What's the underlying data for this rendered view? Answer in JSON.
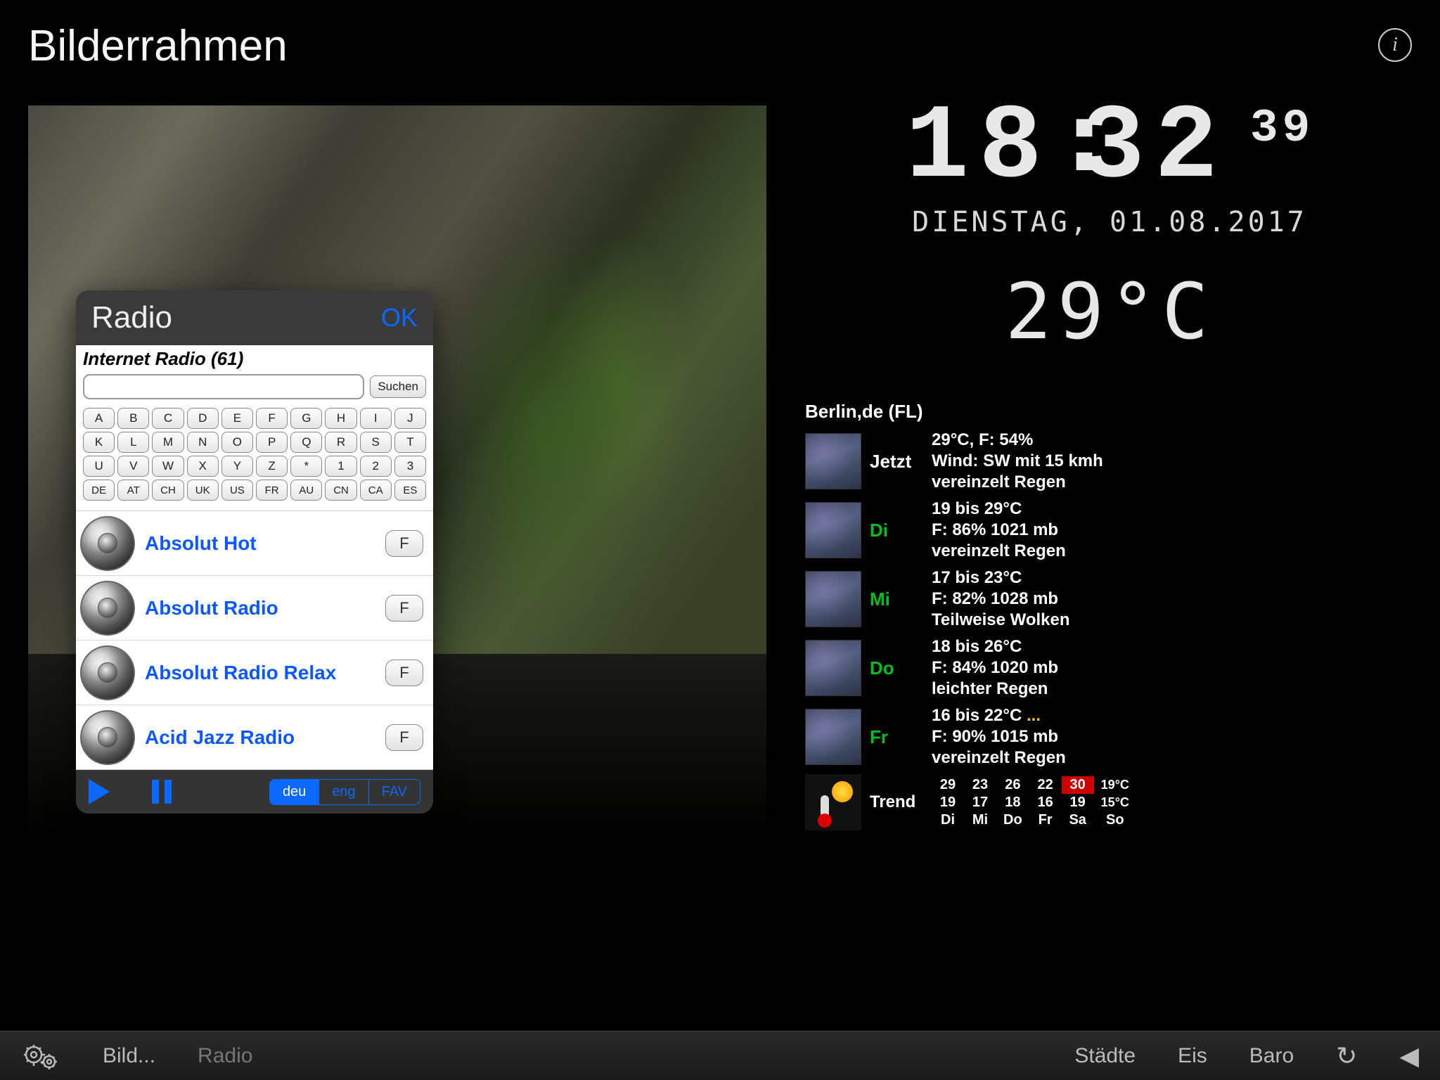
{
  "app_title": "Bilderrahmen",
  "info_glyph": "i",
  "clock": {
    "hh": "18",
    "mm": "32",
    "ss": "39",
    "date": "DIENSTAG, 01.08.2017",
    "temp": "29°C"
  },
  "radio": {
    "title": "Radio",
    "ok": "OK",
    "group_label": "Internet Radio (61)",
    "search_btn": "Suchen",
    "search_value": "",
    "kbd_rows": [
      [
        "A",
        "B",
        "C",
        "D",
        "E",
        "F",
        "G",
        "H",
        "I",
        "J"
      ],
      [
        "K",
        "L",
        "M",
        "N",
        "O",
        "P",
        "Q",
        "R",
        "S",
        "T"
      ],
      [
        "U",
        "V",
        "W",
        "X",
        "Y",
        "Z",
        "*",
        "1",
        "2",
        "3"
      ],
      [
        "DE",
        "AT",
        "CH",
        "UK",
        "US",
        "FR",
        "AU",
        "CN",
        "CA",
        "ES"
      ]
    ],
    "stations": [
      {
        "name": "Absolut Hot",
        "fav": "F"
      },
      {
        "name": "Absolut Radio",
        "fav": "F"
      },
      {
        "name": "Absolut Radio Relax",
        "fav": "F"
      },
      {
        "name": "Acid Jazz Radio",
        "fav": "F"
      }
    ],
    "segments": [
      {
        "label": "deu",
        "active": true
      },
      {
        "label": "eng",
        "active": false
      },
      {
        "label": "FAV",
        "active": false
      }
    ]
  },
  "weather": {
    "city": "Berlin,de (FL)",
    "rows": [
      {
        "day": "Jetzt",
        "now": true,
        "lines": [
          "29°C, F: 54%",
          "Wind: SW mit 15 kmh",
          "vereinzelt Regen"
        ]
      },
      {
        "day": "Di",
        "now": false,
        "lines": [
          "19 bis 29°C",
          "F: 86% 1021 mb",
          "vereinzelt Regen"
        ]
      },
      {
        "day": "Mi",
        "now": false,
        "lines": [
          "17 bis 23°C",
          "F: 82% 1028 mb",
          "Teilweise Wolken"
        ]
      },
      {
        "day": "Do",
        "now": false,
        "lines": [
          "18 bis 26°C",
          "F: 84% 1020 mb",
          "leichter Regen"
        ]
      },
      {
        "day": "Fr",
        "now": false,
        "lines": [
          "16 bis 22°C ...",
          "F: 90% 1015 mb",
          "vereinzelt Regen"
        ]
      }
    ],
    "trend": {
      "label": "Trend",
      "cols": [
        "Di",
        "Mi",
        "Do",
        "Fr",
        "Sa",
        "So"
      ],
      "hi": [
        "29",
        "23",
        "26",
        "22",
        "30",
        "19°C"
      ],
      "lo": [
        "19",
        "17",
        "18",
        "16",
        "19",
        "15°C"
      ],
      "hot_index": 4
    }
  },
  "toolbar": {
    "bild": "Bild...",
    "radio": "Radio",
    "stadte": "Städte",
    "eis": "Eis",
    "baro": "Baro"
  }
}
